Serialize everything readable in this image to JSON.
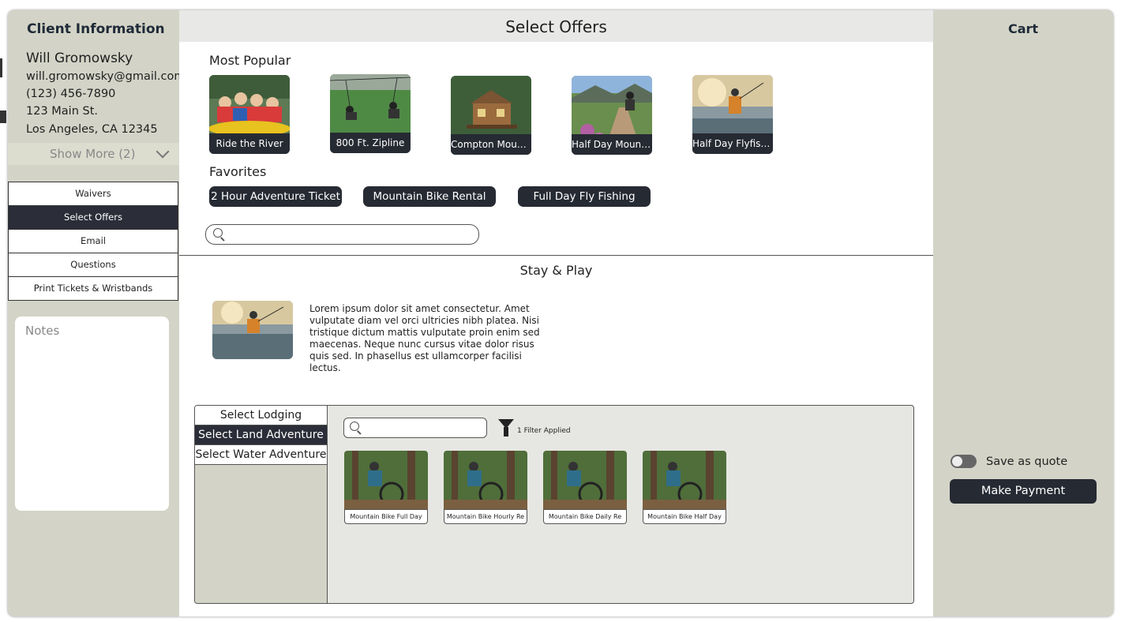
{
  "client": {
    "title": "Client Information",
    "name": "Will Gromowsky",
    "email": "will.gromowsky@gmail.com",
    "phone": "(123) 456-7890",
    "street": "123 Main St.",
    "city": "Los Angeles, CA 12345",
    "show_more": "Show More (2)"
  },
  "nav": {
    "items": [
      "Waivers",
      "Select Offers",
      "Email",
      "Questions",
      "Print Tickets & Wristbands"
    ],
    "active": "Select Offers"
  },
  "notes": {
    "placeholder": "Notes"
  },
  "main": {
    "title": "Select Offers",
    "most_popular_label": "Most Popular",
    "popular": [
      "Ride the River",
      "800 Ft. Zipline",
      "Compton Mount...",
      "Half Day Mount...",
      "Half Day Flyfishi..."
    ],
    "favorites_label": "Favorites",
    "favorites": [
      "2 Hour Adventure Ticket",
      "Mountain Bike Rental",
      "Full Day Fly Fishing"
    ],
    "search_placeholder": ""
  },
  "stay": {
    "title": "Stay & Play",
    "text": "Lorem ipsum dolor sit amet consectetur. Amet vulputate diam vel orci ultricies nibh platea. Nisi tristique dictum mattis vulputate proin enim sed maecenas. Neque nunc cursus vitae dolor risus quis sed. In phasellus est ullamcorper facilisi lectus.",
    "tabs": [
      "Select Lodging",
      "Select Land Adventure",
      "Select Water Adventure"
    ],
    "active_tab": "Select Land Adventure",
    "filter_text": "1 Filter Applied",
    "products": [
      "Mountain Bike Full Day",
      "Mountain Bike Hourly Re",
      "Mountain Bike Daily Re",
      "Mountain Bike Half Day"
    ]
  },
  "cart": {
    "title": "Cart",
    "save_quote": "Save as quote",
    "save_quote_on": false,
    "pay": "Make Payment"
  },
  "colors": {
    "panel": "#d3d4c7",
    "dark": "#262a33",
    "header": "#e8e9e6"
  }
}
